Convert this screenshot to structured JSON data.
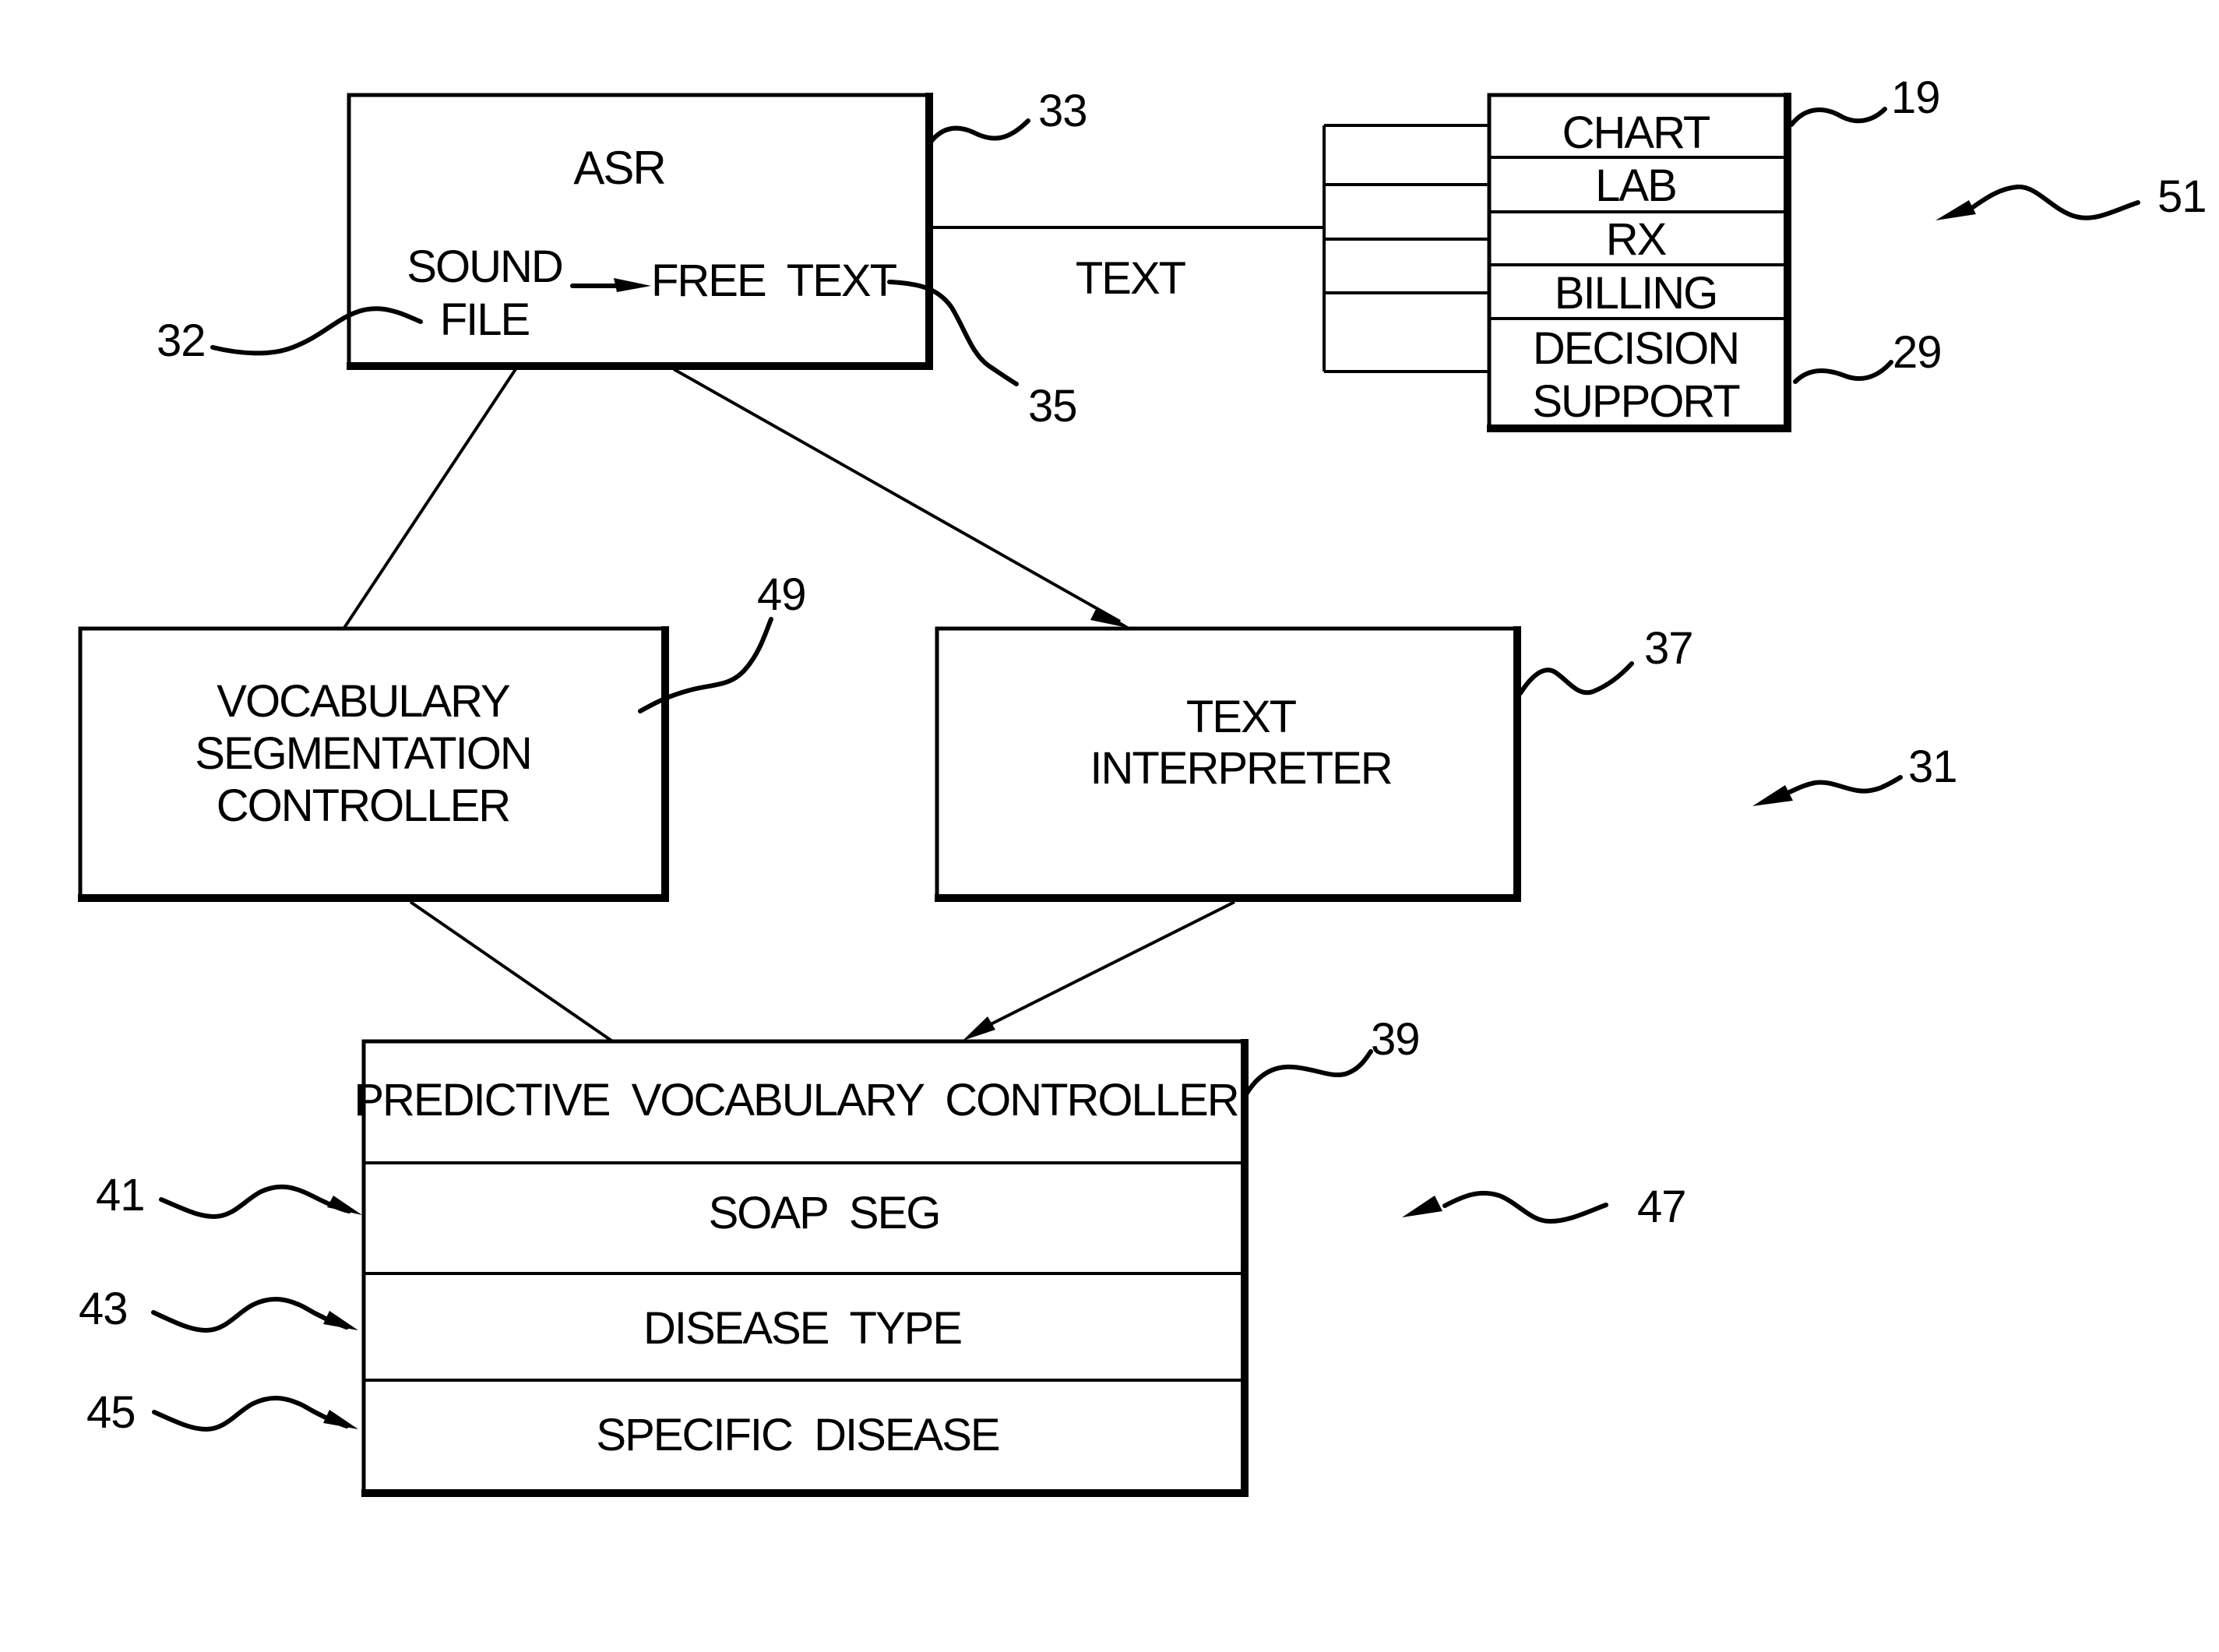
{
  "figure": {
    "asr_block": {
      "title": "ASR",
      "sound_file_line1": "SOUND",
      "sound_file_line2": "FILE",
      "free_text": "FREE  TEXT"
    },
    "text_link_label": "TEXT",
    "output_stack": {
      "items": [
        {
          "label": "CHART"
        },
        {
          "label": "LAB"
        },
        {
          "label": "RX"
        },
        {
          "label": "BILLING"
        },
        {
          "label_line1": "DECISION",
          "label_line2": "SUPPORT"
        }
      ]
    },
    "vocab_seg_controller": {
      "line1": "VOCABULARY",
      "line2": "SEGMENTATION",
      "line3": "CONTROLLER"
    },
    "text_interpreter": {
      "line1": "TEXT",
      "line2": "INTERPRETER"
    },
    "predictive_stack": {
      "rows": [
        {
          "label": "PREDICTIVE  VOCABULARY  CONTROLLER"
        },
        {
          "label": "SOAP  SEG"
        },
        {
          "label": "DISEASE  TYPE"
        },
        {
          "label": "SPECIFIC  DISEASE"
        }
      ]
    },
    "reference_numerals": {
      "asr": "33",
      "sound_file": "32",
      "free_text": "35",
      "chart": "19",
      "decision_support": "29",
      "output_system": "51",
      "vocab_seg": "49",
      "text_interpreter": "37",
      "system": "31",
      "predictive": "39",
      "soap_seg": "41",
      "disease_type": "43",
      "specific_disease": "45",
      "predictive_system": "47"
    }
  }
}
